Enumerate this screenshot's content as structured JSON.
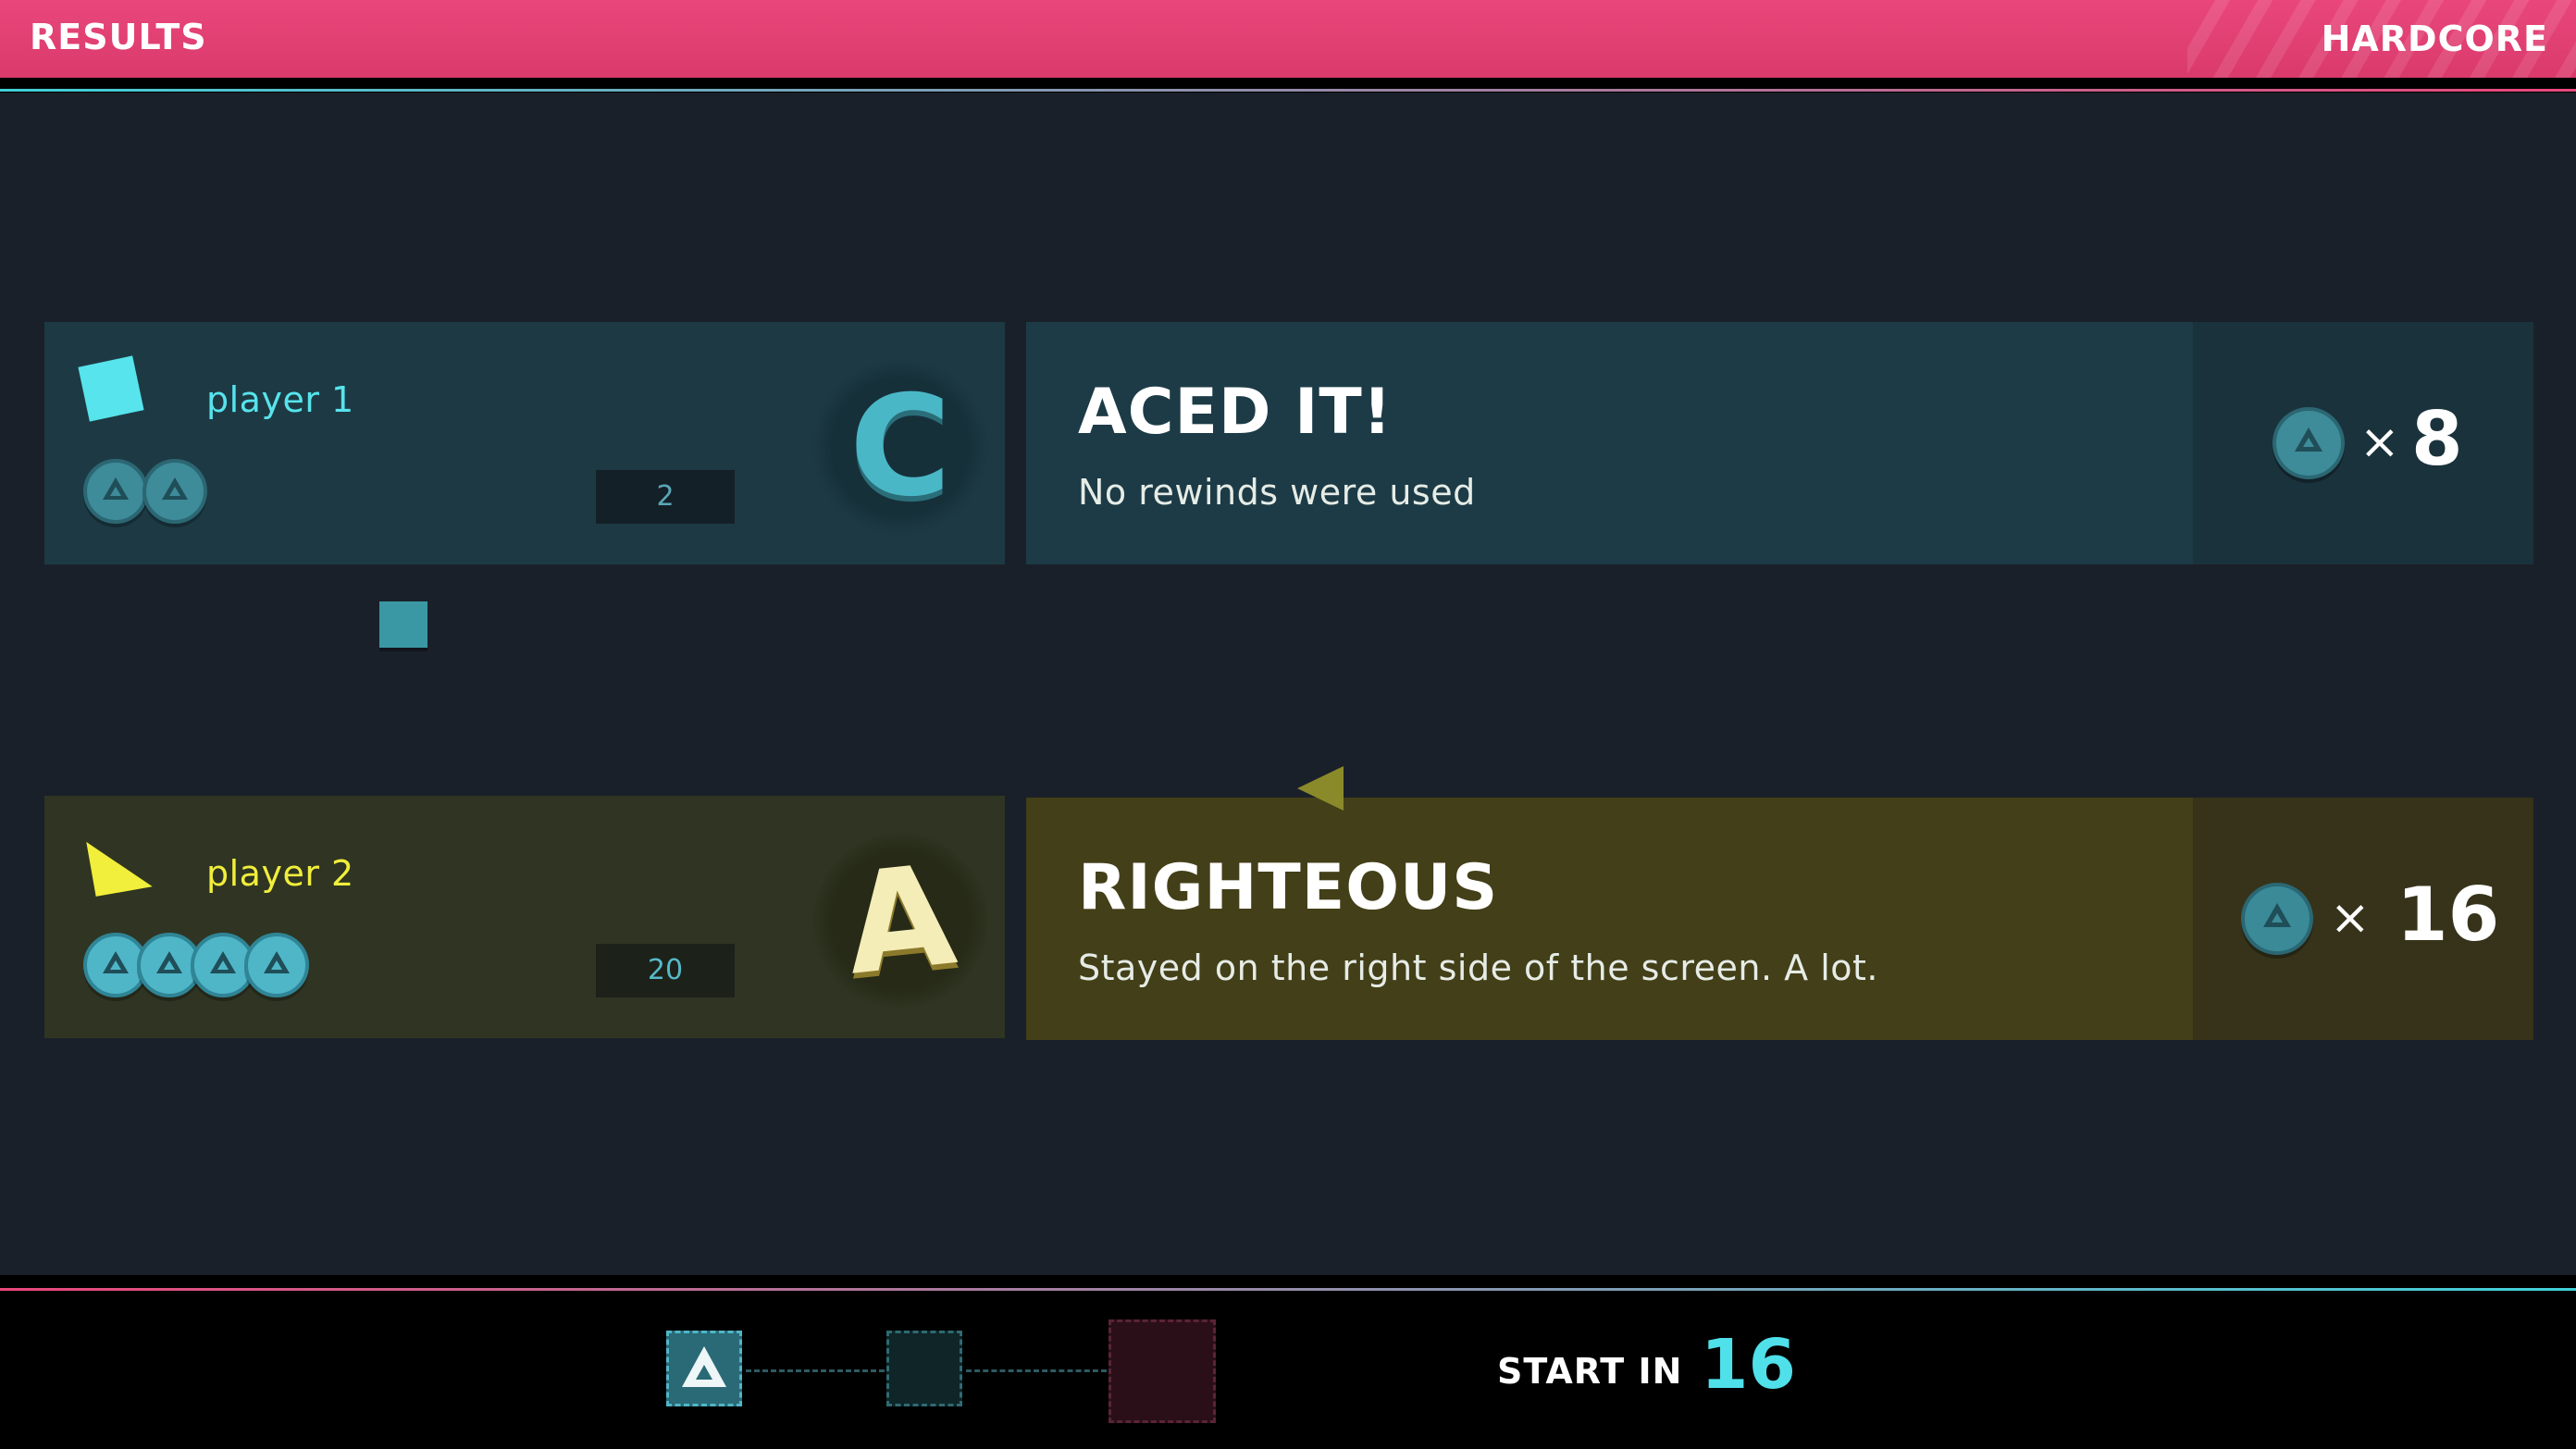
{
  "header": {
    "title": "RESULTS",
    "mode": "HARDCORE"
  },
  "players": [
    {
      "name": "player 1",
      "shape": "square",
      "color": "#57e4ec",
      "tokens": 2,
      "score": "2",
      "grade": "C"
    },
    {
      "name": "player 2",
      "shape": "triangle",
      "color": "#f1ee3c",
      "tokens": 4,
      "score": "20",
      "grade": "A"
    }
  ],
  "awards": [
    {
      "title": "ACED IT!",
      "description": "No rewinds were used",
      "multiplier_symbol": "×",
      "count": "8"
    },
    {
      "title": "RIGHTEOUS",
      "description": "Stayed on the right side of the screen. A lot.",
      "multiplier_symbol": "×",
      "count": "16"
    }
  ],
  "footer": {
    "start_label": "START IN",
    "countdown": "16"
  }
}
